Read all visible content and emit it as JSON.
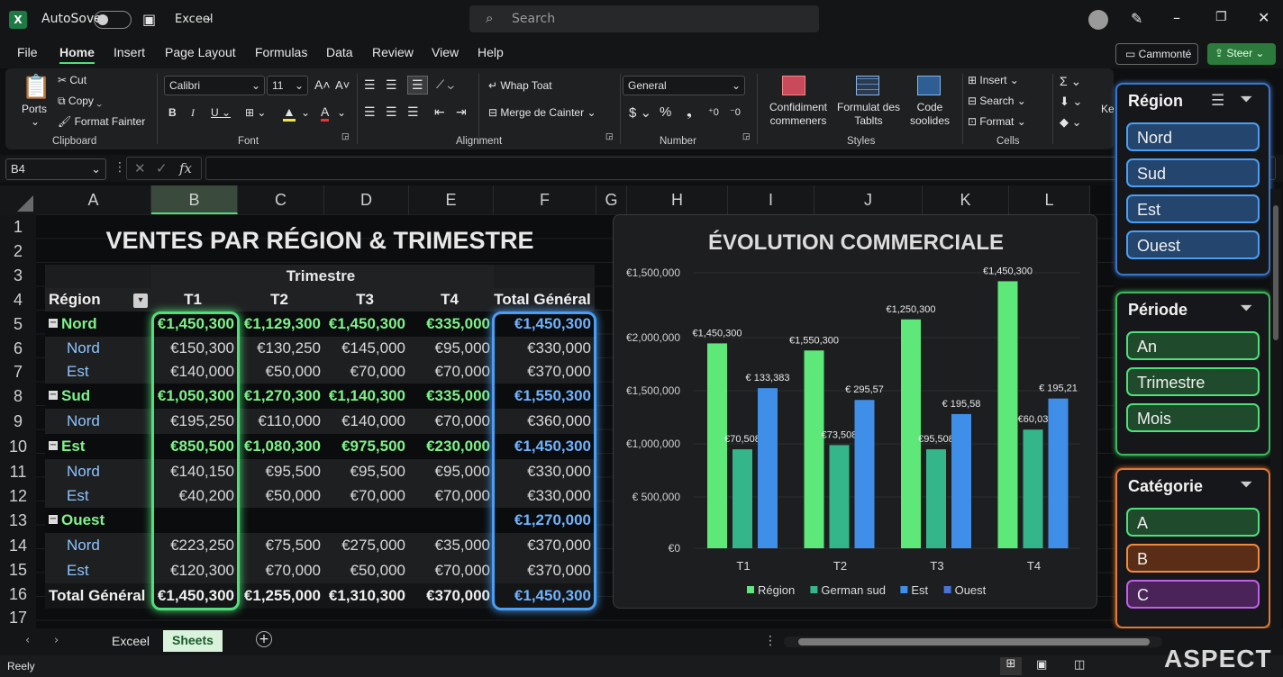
{
  "titlebar": {
    "autosave": "AutoSove",
    "app": "Exceel",
    "search_placeholder": "Search"
  },
  "menu": [
    "File",
    "Home",
    "Insert",
    "Page Layout",
    "Formulas",
    "Data",
    "Review",
    "View",
    "Help"
  ],
  "share": {
    "comment": "Cammonté",
    "share": "Steer"
  },
  "ribbon": {
    "clipboard": {
      "paste": "Ports",
      "cut": "Cut",
      "copy": "Copy",
      "format": "Format Fainter",
      "label": "Clipboard"
    },
    "font": {
      "name": "Calibri",
      "size": "11",
      "label": "Font"
    },
    "alignment": {
      "wrap": "Whap Toat",
      "merge": "Merge de Cainter",
      "label": "Alignment"
    },
    "number": {
      "format": "General",
      "label": "Number"
    },
    "styles": {
      "cond": "Confidiment commeners",
      "table": "Formulat des Tablts",
      "cell": "Code soolides",
      "label": "Styles"
    },
    "cells": {
      "insert": "Insert",
      "delete": "Search",
      "format": "Format",
      "label": "Cells"
    },
    "extra": "Ke"
  },
  "formula": {
    "namebox": "B4"
  },
  "columns": [
    "A",
    "B",
    "C",
    "D",
    "E",
    "F",
    "G",
    "H",
    "I",
    "J",
    "K",
    "L"
  ],
  "rows": [
    "1",
    "2",
    "3",
    "4",
    "5",
    "6",
    "7",
    "8",
    "9",
    "10",
    "11",
    "12",
    "13",
    "14",
    "15",
    "16",
    "17"
  ],
  "table": {
    "title": "VENTES PAR RÉGION & TRIMESTRE",
    "group": "Trimestre",
    "head": [
      "Région",
      "T1",
      "T2",
      "T3",
      "T4",
      "Total Général"
    ],
    "body": [
      [
        "Nord",
        "€1,450,300",
        "€1,129,300",
        "€1,450,300",
        "€335,000",
        "€1,450,300"
      ],
      [
        "Nord",
        "€150,300",
        "€130,250",
        "€145,000",
        "€95,000",
        "€330,000"
      ],
      [
        "Est",
        "€140,000",
        "€50,000",
        "€70,000",
        "€70,000",
        "€370,000"
      ],
      [
        "Sud",
        "€1,050,300",
        "€1,270,300",
        "€1,140,300",
        "€335,000",
        "€1,550,300"
      ],
      [
        "Nord",
        "€195,250",
        "€110,000",
        "€140,000",
        "€70,000",
        "€360,000"
      ],
      [
        "Est",
        "€850,500",
        "€1,080,300",
        "€975,500",
        "€230,000",
        "€1,450,300"
      ],
      [
        "Nord",
        "€140,150",
        "€95,500",
        "€95,500",
        "€95,000",
        "€330,000"
      ],
      [
        "Est",
        "€40,200",
        "€50,000",
        "€70,000",
        "€70,000",
        "€330,000"
      ],
      [
        "Ouest",
        "",
        "",
        "",
        "",
        "€1,270,000"
      ],
      [
        "Nord",
        "€223,250",
        "€75,500",
        "€275,000",
        "€35,000",
        "€370,000"
      ],
      [
        "Est",
        "€120,300",
        "€70,000",
        "€50,000",
        "€70,000",
        "€370,000"
      ],
      [
        "Total Général",
        "€1,450,300",
        "€1,255,000",
        "€1,310,300",
        "€370,000",
        "€1,450,300"
      ]
    ]
  },
  "chart_data": {
    "type": "bar",
    "title": "ÉVOLUTION COMMERCIALE",
    "categories": [
      "T1",
      "T2",
      "T3",
      "T4"
    ],
    "yticks": [
      "€1,500,000",
      "€2,000,000",
      "€1,500,000",
      "€1,000,000",
      "€ 500,000",
      "€0"
    ],
    "series": [
      {
        "name": "Région",
        "values": [
          1450300,
          1400000,
          1620000,
          1890000
        ],
        "labels": [
          "€1,450,300",
          "€1,550,300",
          "€1,250,300",
          "€1,450,300"
        ],
        "color": "#5ee879"
      },
      {
        "name": "German sud",
        "values": [
          700500,
          730500,
          700500,
          840000
        ],
        "labels": [
          "€70,508",
          "€73,508",
          "€95,508",
          "€60,03"
        ],
        "color": "#35b58a"
      },
      {
        "name": "Est",
        "values": [
          1133333,
          1050000,
          950000,
          1060000
        ],
        "labels": [
          "€ 133,383",
          "€ 295,57",
          "€ 195,58",
          "€ 195,21"
        ],
        "color": "#3f8fe8"
      },
      {
        "name": "Ouest",
        "values": [
          0,
          0,
          0,
          0
        ],
        "color": "#4a73d6"
      }
    ],
    "ylim": [
      0,
      1950000
    ]
  },
  "slicers": [
    {
      "title": "Région",
      "items": [
        "Nord",
        "Sud",
        "Est",
        "Ouest"
      ],
      "accent": "#4a9ff5"
    },
    {
      "title": "Période",
      "items": [
        "An",
        "Trimestre",
        "Mois"
      ],
      "accent": "#4fe07a"
    },
    {
      "title": "Catégorie",
      "items": [
        "A",
        "B",
        "C"
      ],
      "accents": [
        "#4fe07a",
        "#f08a3c",
        "#c060e8"
      ]
    }
  ],
  "tabs": [
    "Exceel",
    "Sheets"
  ],
  "status": {
    "ready": "Reely",
    "brand": "ASPECT"
  }
}
